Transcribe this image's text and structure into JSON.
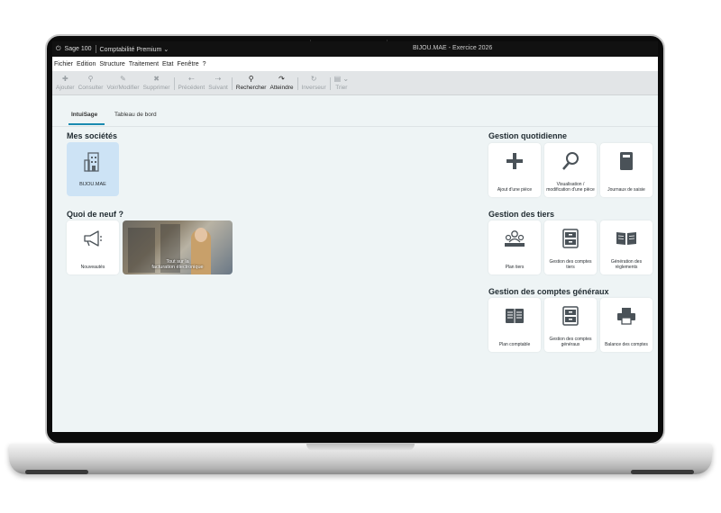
{
  "titlebar": {
    "app": "Sage 100",
    "product": "Comptabilité Premium",
    "window_title": "BIJOU.MAE - Exercice 2026"
  },
  "menu": [
    "Fichier",
    "Edition",
    "Structure",
    "Traitement",
    "Etat",
    "Fenêtre",
    "?"
  ],
  "toolbar": {
    "ajouter": "Ajouter",
    "consulter": "Consulter",
    "voir_modifier": "Voir/Modifier",
    "supprimer": "Supprimer",
    "precedent": "Précédent",
    "suivant": "Suivant",
    "rechercher": "Rechercher",
    "atteindre": "Atteindre",
    "inverseur": "Inverseur",
    "trier": "Trier"
  },
  "tabs": {
    "intuisage": "IntuiSage",
    "tableau_de_bord": "Tableau de bord"
  },
  "mes_societes": {
    "title": "Mes sociétés",
    "company": "BIJOU.MAE"
  },
  "quoi_de_neuf": {
    "title": "Quoi de neuf ?",
    "nouveautes": "Nouveautés",
    "promo_line1": "Tout sur la",
    "promo_line2": "facturation électronique"
  },
  "gestion_quotidienne": {
    "title": "Gestion quotidienne",
    "ajout": "Ajout d'une pièce",
    "visualisation": "Visualisation / modification d'une pièce",
    "journaux": "Journaux de saisie"
  },
  "gestion_tiers": {
    "title": "Gestion des tiers",
    "plan_tiers": "Plan tiers",
    "comptes_tiers": "Gestion des comptes tiers",
    "reglements": "Génération des règlements"
  },
  "gestion_comptes": {
    "title": "Gestion des comptes généraux",
    "plan_comptable": "Plan comptable",
    "comptes_generaux": "Gestion des comptes généraux",
    "balance": "Balance des comptes"
  },
  "colors": {
    "accent": "#1a8ab0",
    "background": "#eef4f5",
    "icon": "#4a5258"
  }
}
